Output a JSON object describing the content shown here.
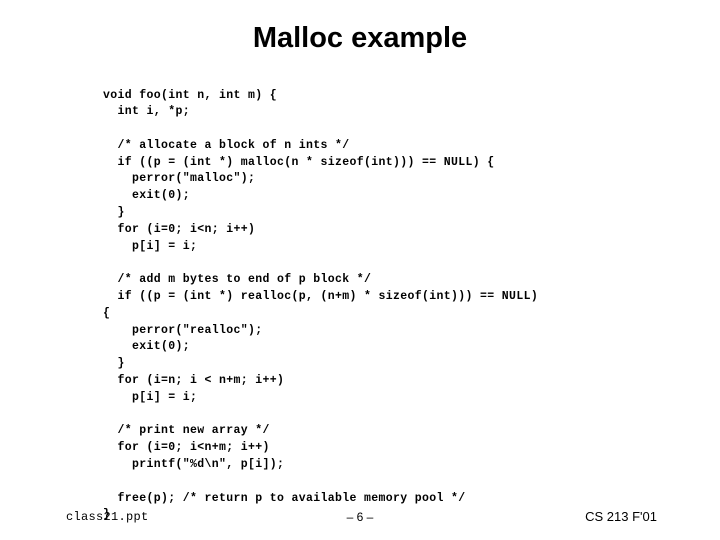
{
  "slide": {
    "title": "Malloc example",
    "code_lines": [
      "void foo(int n, int m) {",
      "  int i, *p;",
      "",
      "  /* allocate a block of n ints */",
      "  if ((p = (int *) malloc(n * sizeof(int))) == NULL) {",
      "    perror(\"malloc\");",
      "    exit(0);",
      "  }",
      "  for (i=0; i<n; i++)",
      "    p[i] = i;",
      "",
      "  /* add m bytes to end of p block */",
      "  if ((p = (int *) realloc(p, (n+m) * sizeof(int))) == NULL)",
      "{",
      "    perror(\"realloc\");",
      "    exit(0);",
      "  }",
      "  for (i=n; i < n+m; i++)",
      "    p[i] = i;",
      "",
      "  /* print new array */",
      "  for (i=0; i<n+m; i++)",
      "    printf(\"%d\\n\", p[i]);",
      "",
      "  free(p); /* return p to available memory pool */",
      "}"
    ],
    "footer": {
      "left": "class21.ppt",
      "center": "– 6 –",
      "right": "CS 213 F'01"
    }
  },
  "colors": {
    "background": "#ffffff",
    "text": "#000000"
  }
}
